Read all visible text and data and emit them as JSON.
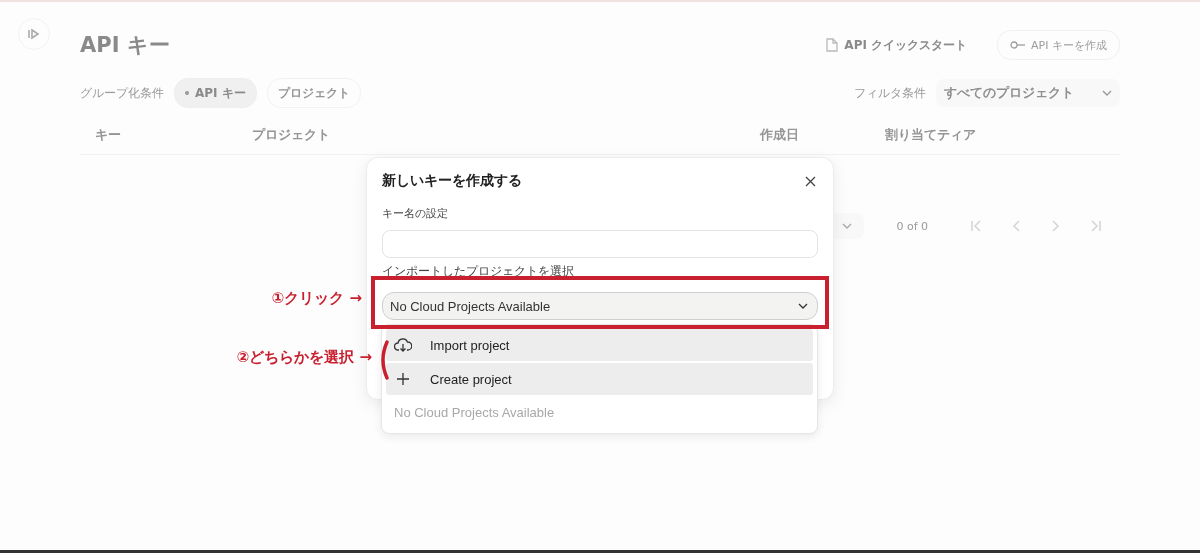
{
  "header": {
    "title": "API キー",
    "quickstart": "API クイックスタート",
    "create_button": {
      "label": "API キーを作成",
      "disabled": true
    }
  },
  "group_by": {
    "label": "グループ化条件",
    "options": [
      {
        "label": "API キー",
        "selected": true
      },
      {
        "label": "プロジェクト",
        "selected": false
      }
    ]
  },
  "filter": {
    "label": "フィルタ条件",
    "value": "すべてのプロジェクト"
  },
  "table": {
    "columns": [
      "キー",
      "プロジェクト",
      "作成日",
      "割り当てティア"
    ]
  },
  "pagination": {
    "range": "0 of 0"
  },
  "dialog": {
    "title": "新しいキーを作成する",
    "name_label": "キー名の設定",
    "project_label": "インポートしたプロジェクトを選択",
    "project_select": {
      "value": "No Cloud Projects Available",
      "expanded": true
    },
    "menu": [
      {
        "kind": "import",
        "label": "Import project"
      },
      {
        "kind": "create",
        "label": "Create project"
      }
    ],
    "empty_note": "No Cloud Projects Available"
  },
  "annotations": [
    {
      "kind": "click",
      "label": "①クリック →"
    },
    {
      "kind": "choose",
      "label": "②どちらかを選択 →"
    }
  ]
}
